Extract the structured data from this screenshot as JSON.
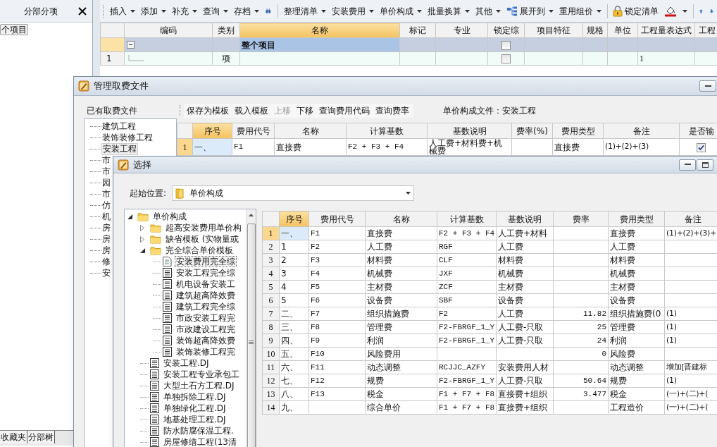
{
  "side_panel": {
    "title": "分部分项",
    "tree": [
      {
        "label": "个项目",
        "selected": true
      }
    ],
    "tabs": [
      {
        "label": "收藏夹"
      },
      {
        "label": "分部树"
      }
    ]
  },
  "toolbar": [
    {
      "label": "插入",
      "dropdown": true
    },
    {
      "label": "添加",
      "dropdown": true
    },
    {
      "label": "补充",
      "dropdown": true
    },
    {
      "label": "查询",
      "dropdown": true
    },
    {
      "label": "存档",
      "dropdown": true
    },
    {
      "kind": "icon",
      "dropdown": false
    },
    {
      "kind": "separator"
    },
    {
      "label": "整理清单",
      "dropdown": true
    },
    {
      "label": "安装费用",
      "dropdown": true
    },
    {
      "label": "单价构成",
      "dropdown": true
    },
    {
      "label": "批量换算",
      "dropdown": true
    },
    {
      "label": "其他",
      "dropdown": true
    },
    {
      "label": "展开到",
      "icon": true,
      "dropdown": true
    },
    {
      "label": "重用组价",
      "dropdown": true
    },
    {
      "kind": "separator"
    },
    {
      "label": "锁定清单",
      "icon": true,
      "dropdown": false
    },
    {
      "kind": "icon",
      "dropdown": true
    },
    {
      "kind": "separator"
    },
    {
      "kind": "icon",
      "dropdown": false
    },
    {
      "kind": "icon",
      "dropdown": false
    }
  ],
  "grid": {
    "columns": [
      {
        "label": "编码",
        "selected": false
      },
      {
        "label": "类别",
        "selected": false
      },
      {
        "label": "名称",
        "selected": true
      },
      {
        "label": "标记",
        "selected": false
      },
      {
        "label": "专业",
        "selected": false
      },
      {
        "label": "锁定综",
        "selected": false
      },
      {
        "label": "项目特征",
        "selected": false
      },
      {
        "label": "规格",
        "selected": false
      },
      {
        "label": "单位",
        "selected": false
      },
      {
        "label": "工程量表达式",
        "selected": false
      },
      {
        "label": "工程",
        "selected": false
      }
    ],
    "rows": [
      {
        "kind": "group",
        "selected": true,
        "name": "整个项目",
        "expanded": true,
        "locked": false
      },
      {
        "kind": "item",
        "selected": false,
        "number": "1",
        "type": "项",
        "locked": false,
        "quantity_expression": "1"
      }
    ]
  },
  "fee_dialog": {
    "title": "管理取费文件",
    "files_title": "已有取费文件",
    "files": [
      {
        "label": "建筑工程",
        "selected": false
      },
      {
        "label": "装饰装修工程",
        "selected": false
      },
      {
        "label": "安装工程",
        "selected": true
      },
      {
        "label": "市",
        "selected": false
      },
      {
        "label": "市",
        "selected": false
      },
      {
        "label": "园",
        "selected": false
      },
      {
        "label": "市",
        "selected": false
      },
      {
        "label": "仿",
        "selected": false
      },
      {
        "label": "机",
        "selected": false
      },
      {
        "label": "房",
        "selected": false
      },
      {
        "label": "房",
        "selected": false
      },
      {
        "label": "房",
        "selected": false
      },
      {
        "label": "修",
        "selected": false
      },
      {
        "label": "安",
        "selected": false
      }
    ],
    "toolbar": [
      {
        "label": "保存为模板",
        "disabled": false
      },
      {
        "label": "载入模板",
        "disabled": false
      },
      {
        "label": "上移",
        "disabled": true
      },
      {
        "label": "下移",
        "disabled": false
      },
      {
        "label": "查询费用代码",
        "disabled": false
      },
      {
        "label": "查询费率",
        "disabled": false
      }
    ],
    "file_label": "单价构成文件：安装工程",
    "table": {
      "columns": [
        {
          "label": "序号",
          "selected": true
        },
        {
          "label": "费用代号",
          "selected": false
        },
        {
          "label": "名称",
          "selected": false
        },
        {
          "label": "计算基数",
          "selected": false
        },
        {
          "label": "基数说明",
          "selected": false
        },
        {
          "label": "费率(%)",
          "selected": false
        },
        {
          "label": "费用类型",
          "selected": false
        },
        {
          "label": "备注",
          "selected": false
        },
        {
          "label": "是否输",
          "selected": false
        }
      ],
      "rows": [
        {
          "number": "1",
          "selected": true,
          "seq": "一、",
          "code": "F1",
          "name": "直接费",
          "base": "F2 + F3 + F4",
          "base_desc": "人工费+材料费+机械费",
          "type": "直接费",
          "note": "(1)+(2)+(3)",
          "output": true
        }
      ]
    }
  },
  "select_dialog": {
    "title": "选择",
    "start_label": "起始位置:",
    "start_value": "单价构成",
    "tree": [
      {
        "label": "单价构成",
        "kind": "folder",
        "expanded": true,
        "selected": false,
        "children": [
          {
            "label": "超高安装费用单价构",
            "kind": "folder",
            "expanded": false,
            "selected": false
          },
          {
            "label": "缺省模板 (实物量或",
            "kind": "folder",
            "expanded": false,
            "selected": false
          },
          {
            "label": "完全综合单价模板",
            "kind": "folder",
            "expanded": true,
            "selected": false,
            "children": [
              {
                "label": "安装费用完全综",
                "kind": "file",
                "selected": true
              },
              {
                "label": "安装工程完全综",
                "kind": "file",
                "selected": false
              },
              {
                "label": "机电设备安装工",
                "kind": "file",
                "selected": false
              },
              {
                "label": "建筑超高降效费",
                "kind": "file",
                "selected": false
              },
              {
                "label": "建筑工程完全综",
                "kind": "file",
                "selected": false
              },
              {
                "label": "市政安装工程完",
                "kind": "file",
                "selected": false
              },
              {
                "label": "市政建设工程完",
                "kind": "file",
                "selected": false
              },
              {
                "label": "装饰超高降效费",
                "kind": "file",
                "selected": false
              },
              {
                "label": "装饰装修工程完",
                "kind": "file",
                "selected": false
              }
            ]
          },
          {
            "label": "安装工程.DJ",
            "kind": "file",
            "selected": false
          },
          {
            "label": "安装工程专业承包工",
            "kind": "file",
            "selected": false
          },
          {
            "label": "大型土石方工程.DJ",
            "kind": "file",
            "selected": false
          },
          {
            "label": "单独拆除工程.DJ",
            "kind": "file",
            "selected": false
          },
          {
            "label": "单独绿化工程.DJ",
            "kind": "file",
            "selected": false
          },
          {
            "label": "地基处理工程.DJ",
            "kind": "file",
            "selected": false
          },
          {
            "label": "防水防腐保温工程.",
            "kind": "file",
            "selected": false
          },
          {
            "label": "房屋修缮工程(13清",
            "kind": "file",
            "selected": false
          }
        ]
      }
    ],
    "table": {
      "columns": [
        {
          "label": "序号",
          "selected": true
        },
        {
          "label": "费用代号",
          "selected": false
        },
        {
          "label": "名称",
          "selected": false
        },
        {
          "label": "计算基数",
          "selected": false
        },
        {
          "label": "基数说明",
          "selected": false
        },
        {
          "label": "费率",
          "selected": false
        },
        {
          "label": "费用类型",
          "selected": false
        },
        {
          "label": "备注",
          "selected": false
        }
      ],
      "rows": [
        {
          "number": "1",
          "selected": true,
          "seq": "一、",
          "code": "F1",
          "name": "直接费",
          "base": "F2 + F3 + F4",
          "base_desc": "人工费+材料",
          "type": "直接费",
          "note": "(1)+(2)+(3)+"
        },
        {
          "number": "2",
          "selected": false,
          "seq": "1",
          "code": "F2",
          "name": "人工费",
          "base": "RGF",
          "base_desc": "人工费",
          "type": "人工费"
        },
        {
          "number": "3",
          "selected": false,
          "seq": "2",
          "code": "F3",
          "name": "材料费",
          "base": "CLF",
          "base_desc": "材料费",
          "type": "材料费"
        },
        {
          "number": "4",
          "selected": false,
          "seq": "3",
          "code": "F4",
          "name": "机械费",
          "base": "JXF",
          "base_desc": "机械费",
          "type": "机械费"
        },
        {
          "number": "5",
          "selected": false,
          "seq": "4",
          "code": "F5",
          "name": "主材费",
          "base": "ZCF",
          "base_desc": "主材费",
          "type": "主材费"
        },
        {
          "number": "6",
          "selected": false,
          "seq": "5",
          "code": "F6",
          "name": "设备费",
          "base": "SBF",
          "base_desc": "设备费",
          "type": "设备费"
        },
        {
          "number": "7",
          "selected": false,
          "seq": "二、",
          "code": "F7",
          "name": "组织措施费",
          "base": "F2",
          "base_desc": "人工费",
          "rate": "11.82",
          "type": "组织措施费(0",
          "note": "(1)"
        },
        {
          "number": "8",
          "selected": false,
          "seq": "三、",
          "code": "F8",
          "name": "管理费",
          "base": "F2-FBRGF_1_Y",
          "base_desc": "人工费-只取",
          "rate": "25",
          "type": "管理费",
          "note": "(1)"
        },
        {
          "number": "9",
          "selected": false,
          "seq": "四、",
          "code": "F9",
          "name": "利润",
          "base": "F2-FBRGF_1_Y",
          "base_desc": "人工费-只取",
          "rate": "24",
          "type": "利润",
          "note": "(1)"
        },
        {
          "number": "10",
          "selected": false,
          "seq": "五、",
          "code": "F10",
          "name": "风险费用",
          "rate": "0",
          "type": "风险费"
        },
        {
          "number": "11",
          "selected": false,
          "seq": "六、",
          "code": "F11",
          "name": "动态调整",
          "base": "RCJJC_AZFY",
          "base_desc": "安装费用人材",
          "type": "动态调整",
          "note": "增加[晋建标"
        },
        {
          "number": "12",
          "selected": false,
          "seq": "七、",
          "code": "F12",
          "name": "规费",
          "base": "F2-FBRGF_1_Y",
          "base_desc": "人工费-只取",
          "rate": "50.64",
          "type": "规费",
          "note": "(1)"
        },
        {
          "number": "13",
          "selected": false,
          "seq": "八、",
          "code": "F13",
          "name": "税金",
          "base": "F1 + F7 + F8",
          "base_desc": "直接费+组织",
          "rate": "3.477",
          "type": "税金",
          "note": "(一)+(二)+("
        },
        {
          "number": "14",
          "selected": false,
          "seq": "九、",
          "name": "综合单价",
          "base": "F1 + F7 + F8",
          "base_desc": "直接费+组织",
          "type": "工程造价",
          "note": "(一)+(二)+("
        }
      ]
    }
  }
}
